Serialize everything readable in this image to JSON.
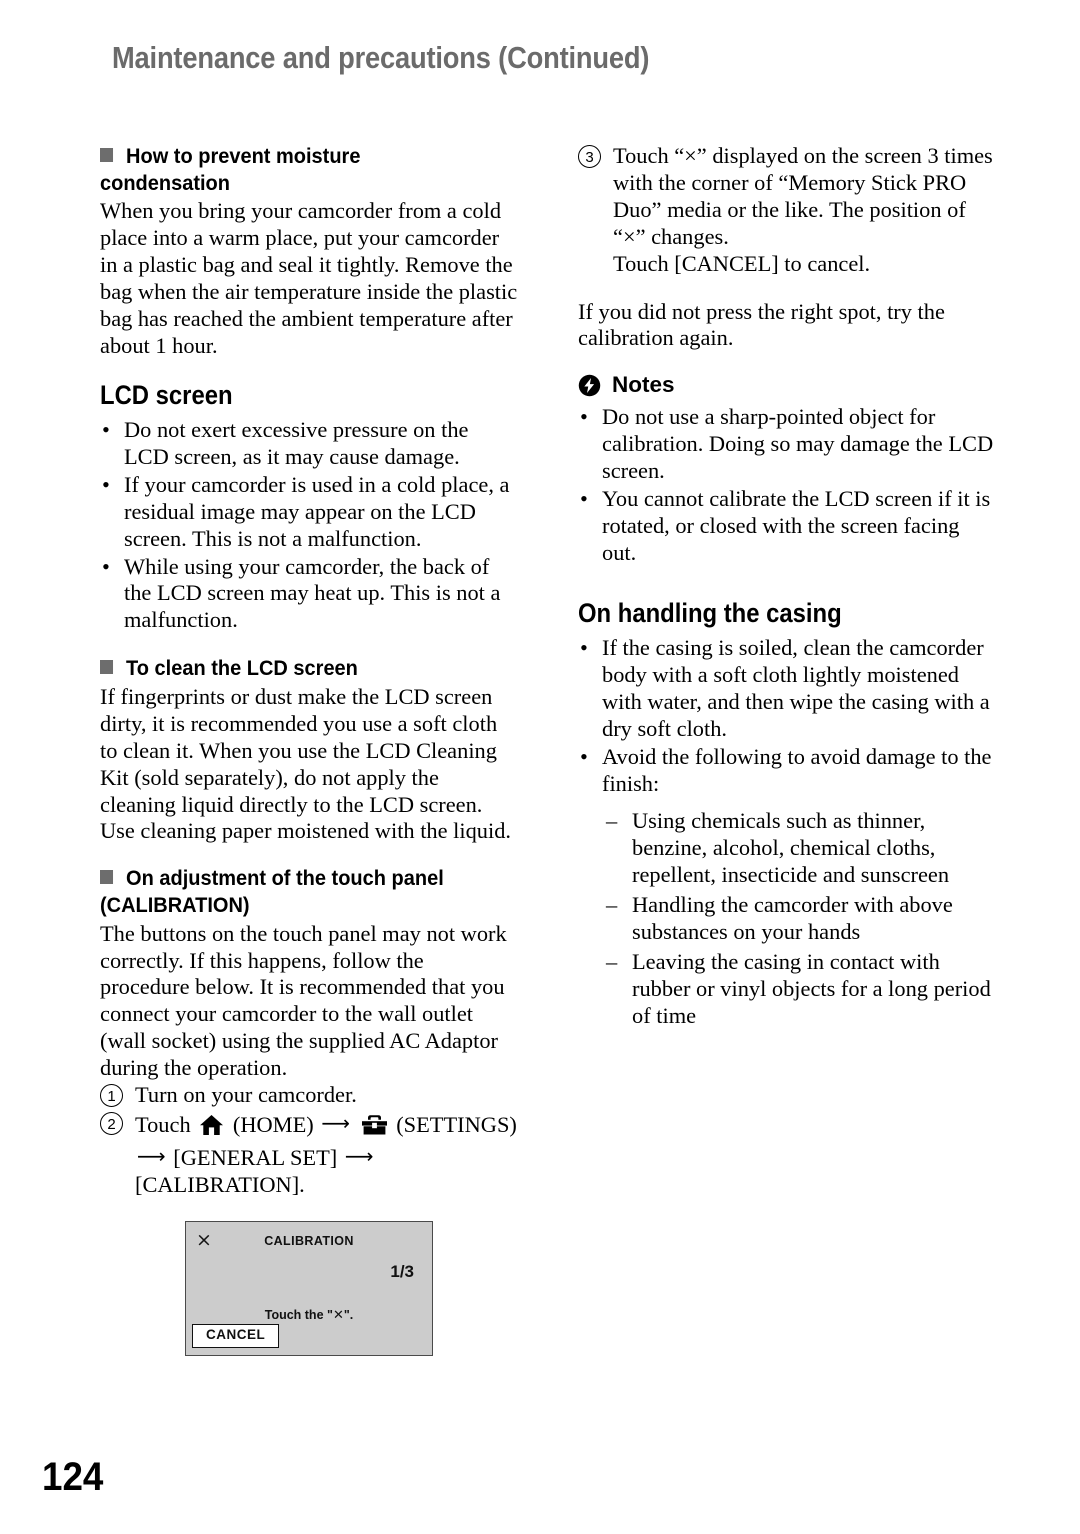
{
  "running_head": "Maintenance and precautions (Continued)",
  "page_number": "124",
  "icons": {
    "section_bullet": "gray-square-bullet",
    "notes": "lightning-bolt-circle-icon",
    "home": "house-icon",
    "settings": "toolbox-icon",
    "arrow": "right-arrow-icon"
  },
  "left_column": {
    "moisture": {
      "heading": "How to prevent moisture condensation",
      "body": "When you bring your camcorder from a cold place into a warm place, put your camcorder in a plastic bag and seal it tightly. Remove the bag when the air temperature inside the plastic bag has reached the ambient temperature after about 1 hour."
    },
    "lcd_screen": {
      "heading": "LCD screen",
      "bullets": [
        "Do not exert excessive pressure on the LCD screen, as it may cause damage.",
        "If your camcorder is used in a cold place, a residual image may appear on the LCD screen. This is not a malfunction.",
        "While using your camcorder, the back of the LCD screen may heat up. This is not a malfunction."
      ]
    },
    "clean_lcd": {
      "heading": "To clean the LCD screen",
      "body": "If fingerprints or dust make the LCD screen dirty, it is recommended you use a soft cloth to clean it. When you use the LCD Cleaning Kit (sold separately), do not apply the cleaning liquid directly to the LCD screen. Use cleaning paper moistened with the liquid."
    },
    "calibration": {
      "heading_line1": "On adjustment of the touch panel",
      "heading_line2": "(CALIBRATION)",
      "body": "The buttons on the touch panel may not work correctly. If this happens, follow the procedure below. It is recommended that you connect your camcorder to the wall outlet (wall socket) using the supplied AC Adaptor during the operation.",
      "step1_number": "1",
      "step1_text": "Turn on your camcorder.",
      "step2_number": "2",
      "step2_touch": "Touch",
      "step2_home_label": "(HOME)",
      "step2_settings_label": "(SETTINGS)",
      "step2_general_set": "[GENERAL SET]",
      "step2_calibration": "[CALIBRATION]."
    },
    "figure": {
      "x_mark": "×",
      "title": "CALIBRATION",
      "page_indicator": "1/3",
      "touch_prefix": "Touch the \"",
      "touch_x": "✕",
      "touch_suffix": "\".",
      "cancel_label": "CANCEL"
    }
  },
  "right_column": {
    "step3": {
      "number": "3",
      "line1": "Touch “×” displayed on the screen 3 times with the corner of “Memory Stick PRO Duo” media or the like. The position of “×” changes.",
      "line2": "Touch [CANCEL] to cancel."
    },
    "retry_note": "If you did not press the right spot, try the calibration again.",
    "notes": {
      "heading": "Notes",
      "items": [
        "Do not use a sharp-pointed object for calibration. Doing so may damage the LCD screen.",
        "You cannot calibrate the LCD screen if it is rotated, or closed with the screen facing out."
      ]
    },
    "casing": {
      "heading": "On handling the casing",
      "bullets": [
        "If the casing is soiled, clean the camcorder body with a soft cloth lightly moistened with water, and then wipe the casing with a dry soft cloth.",
        "Avoid the following to avoid damage to the finish:"
      ],
      "sub_items": [
        "Using chemicals such as thinner, benzine, alcohol, chemical cloths, repellent, insecticide and sunscreen",
        "Handling the camcorder with above substances on your hands",
        "Leaving the casing in contact with rubber or vinyl objects for a long period of time"
      ]
    }
  }
}
